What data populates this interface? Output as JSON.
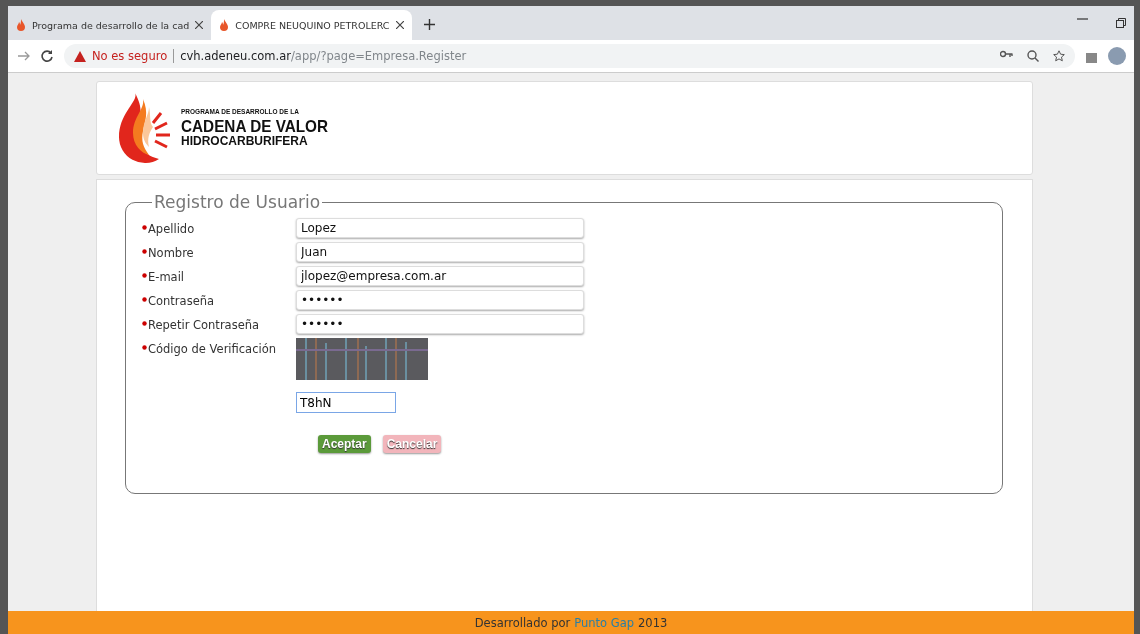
{
  "tabs": [
    {
      "title": "Programa de desarrollo de la cad",
      "selected": false
    },
    {
      "title": "COMPRE NEUQUINO PETROLERC",
      "selected": true
    }
  ],
  "address_bar": {
    "security": "No es seguro",
    "host": "cvh.adeneu.com.ar",
    "path": "/app/?page=Empresa.Register"
  },
  "logo": {
    "line_1": "PROGRAMA DE DESARROLLO DE LA",
    "line_2": "CADENA DE VALOR",
    "line_3": "HIDROCARBURIFERA"
  },
  "form": {
    "legend": "Registro de Usuario",
    "fields": [
      {
        "label": "Apellido",
        "value": "Lopez",
        "required": true
      },
      {
        "label": "Nombre",
        "value": "Juan",
        "required": true
      },
      {
        "label": "E-mail",
        "value": "jlopez@empresa.com.ar",
        "required": true
      },
      {
        "label": "Contraseña",
        "value": "••••••",
        "required": true
      },
      {
        "label": "Repetir Contraseña",
        "value": "••••••",
        "required": true
      }
    ],
    "captcha": {
      "label": "Código de Verificación",
      "value": "T8hN",
      "required": true
    },
    "buttons": [
      {
        "label": "Aceptar",
        "kind": "primary"
      },
      {
        "label": "Cancelar",
        "kind": "cancel"
      }
    ]
  },
  "footer": {
    "prefix": "Desarrollado por",
    "link": "Punto Gap",
    "year": "2013"
  }
}
